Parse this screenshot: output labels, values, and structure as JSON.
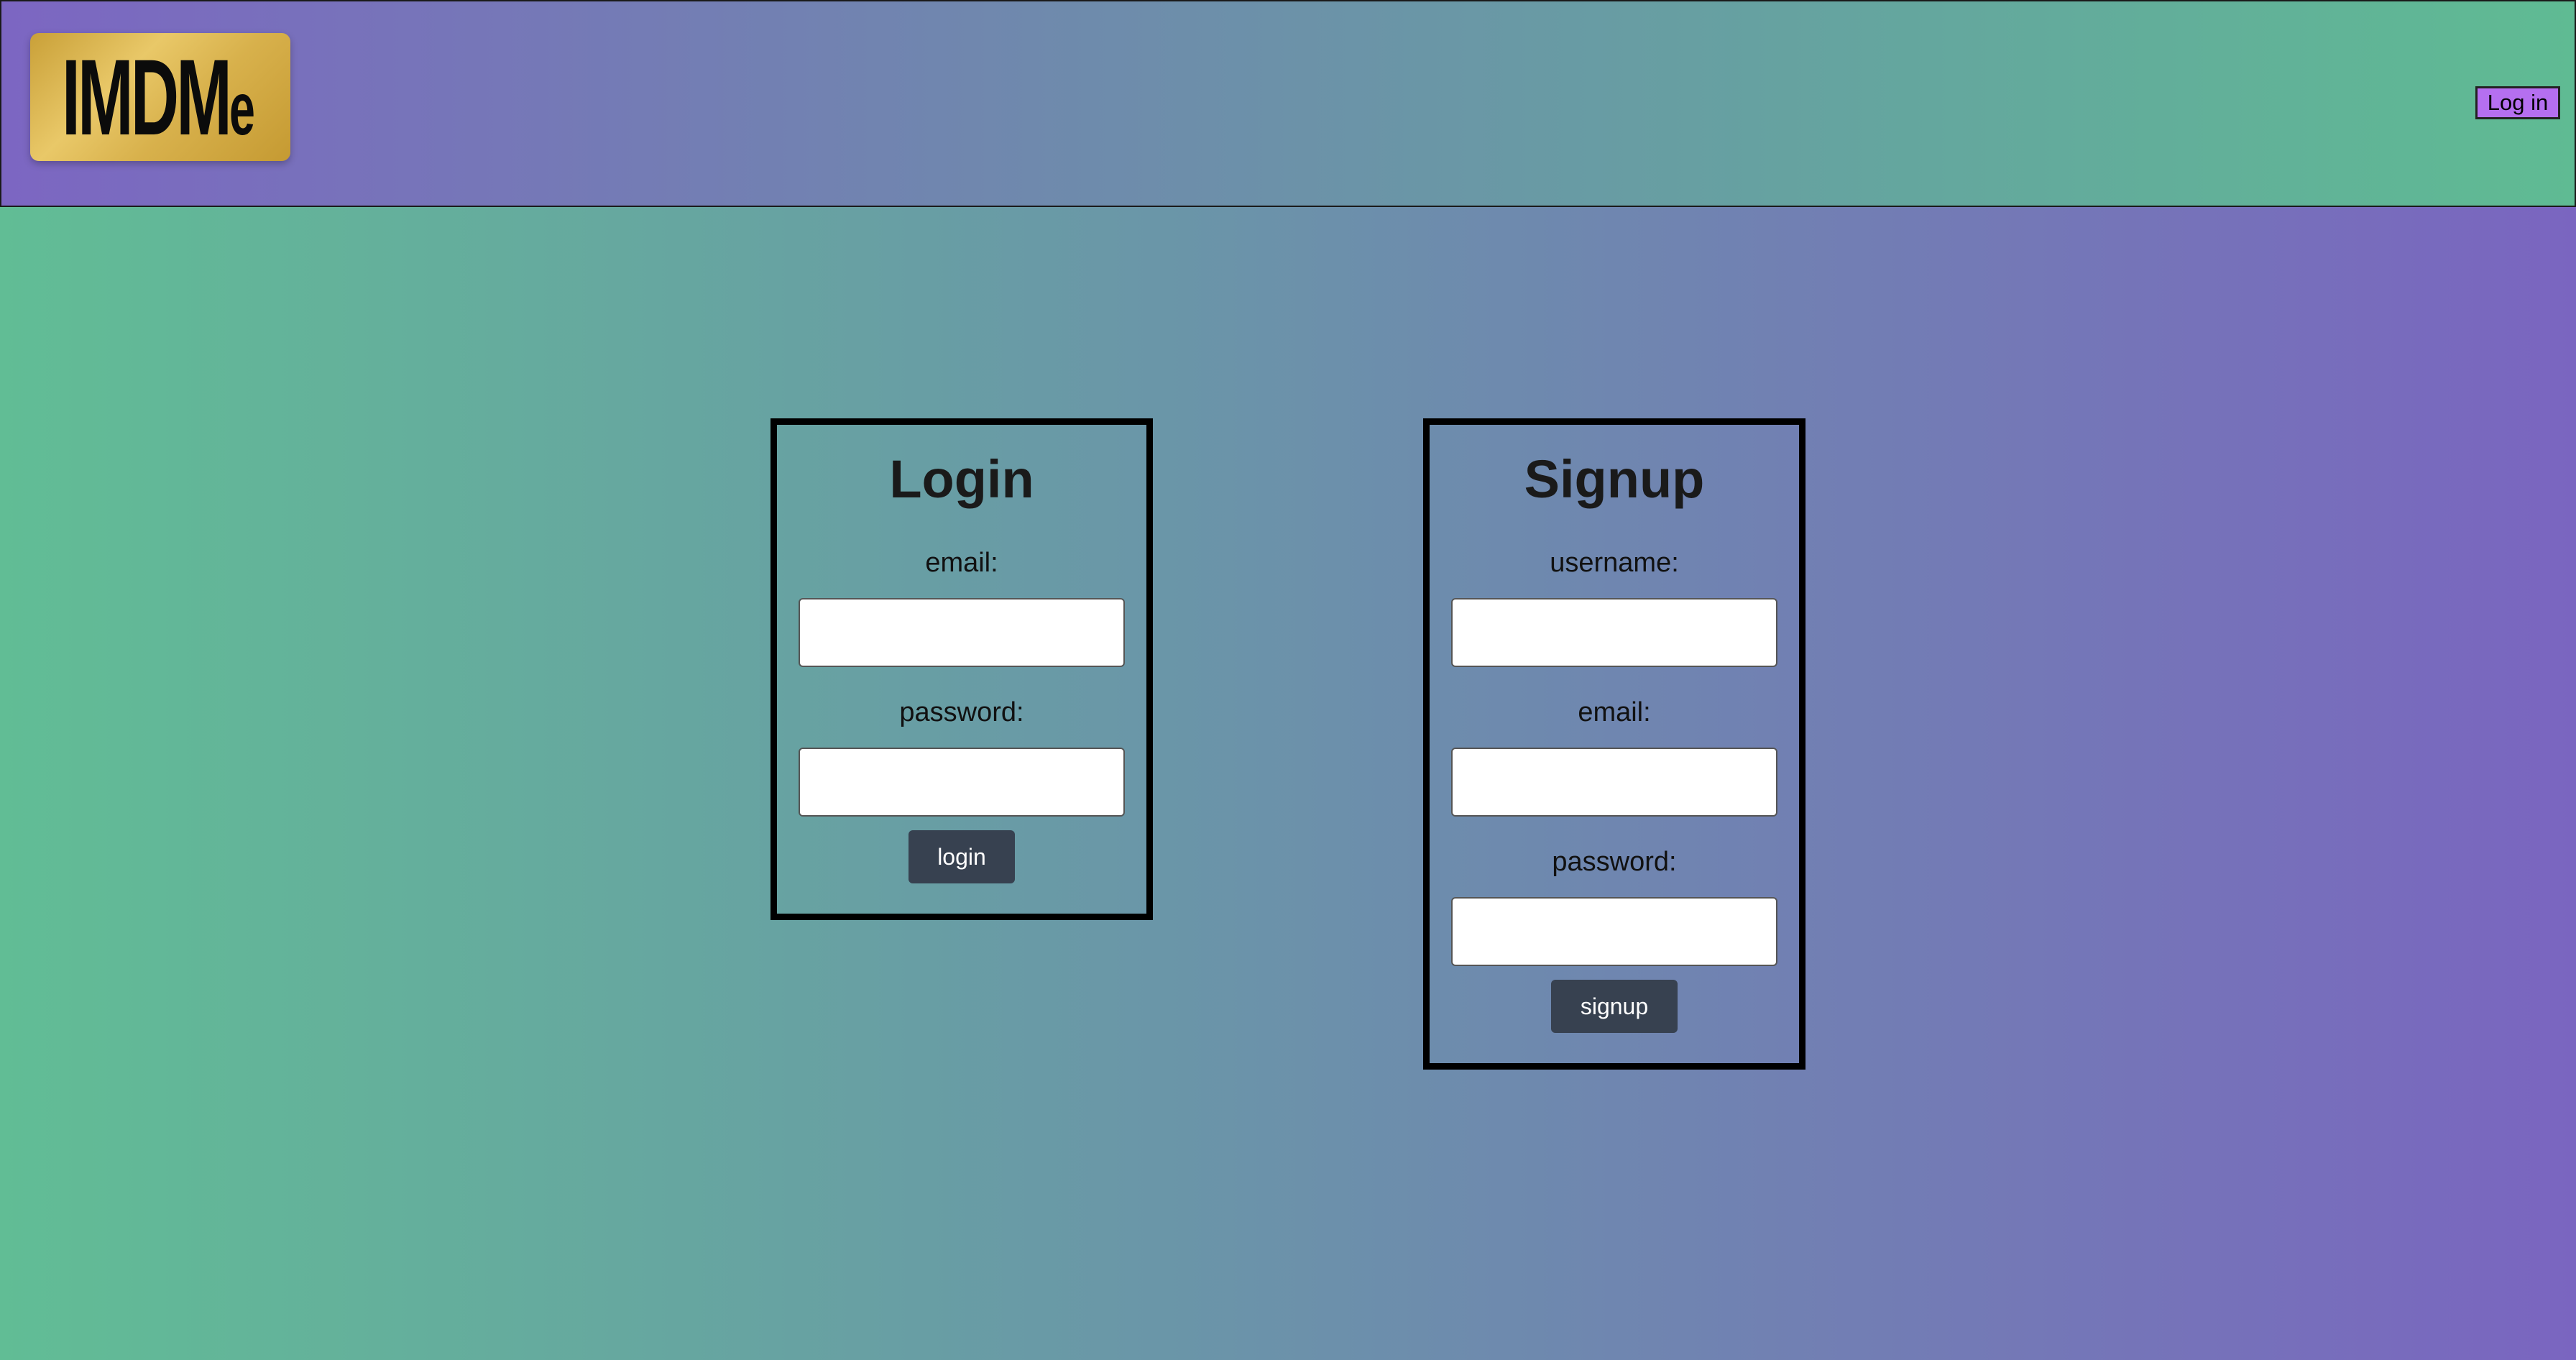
{
  "header": {
    "logo_text_main": "IMDM",
    "logo_text_suffix": "e",
    "login_button": "Log in"
  },
  "login_panel": {
    "title": "Login",
    "email_label": "email:",
    "email_value": "",
    "password_label": "password:",
    "password_value": "",
    "submit_label": "login"
  },
  "signup_panel": {
    "title": "Signup",
    "username_label": "username:",
    "username_value": "",
    "email_label": "email:",
    "email_value": "",
    "password_label": "password:",
    "password_value": "",
    "submit_label": "signup"
  },
  "colors": {
    "logo_gold": "#d8b14c",
    "header_button_purple": "#b56ff0",
    "button_dark": "#374150"
  }
}
